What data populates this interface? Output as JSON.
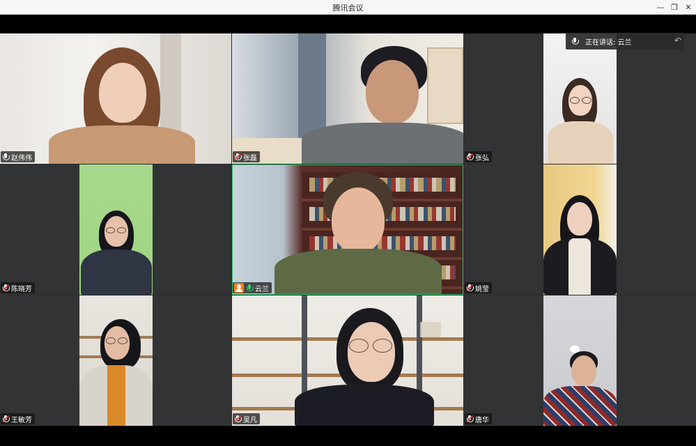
{
  "window": {
    "title": "腾讯会议",
    "controls": {
      "minimize": "—",
      "maximize": "❐",
      "close": "✕"
    }
  },
  "speaking_indicator": {
    "text": "正在讲话: 云兰",
    "back_icon": "↶"
  },
  "participants": [
    {
      "name": "赵伟伟",
      "mic": "on"
    },
    {
      "name": "张磊",
      "mic": "off"
    },
    {
      "name": "张弘",
      "mic": "off"
    },
    {
      "name": "陈晓芳",
      "mic": "off"
    },
    {
      "name": "云兰",
      "mic": "speaking",
      "host": true
    },
    {
      "name": "姚莹",
      "mic": "off"
    },
    {
      "name": "王敏芳",
      "mic": "off"
    },
    {
      "name": "吴凡",
      "mic": "off"
    },
    {
      "name": "唐华",
      "mic": "off"
    }
  ],
  "colors": {
    "grid_bg": "#2c2e30",
    "active_speaker_border": "#2fbf6a",
    "host_badge": "#ff7a1a"
  }
}
